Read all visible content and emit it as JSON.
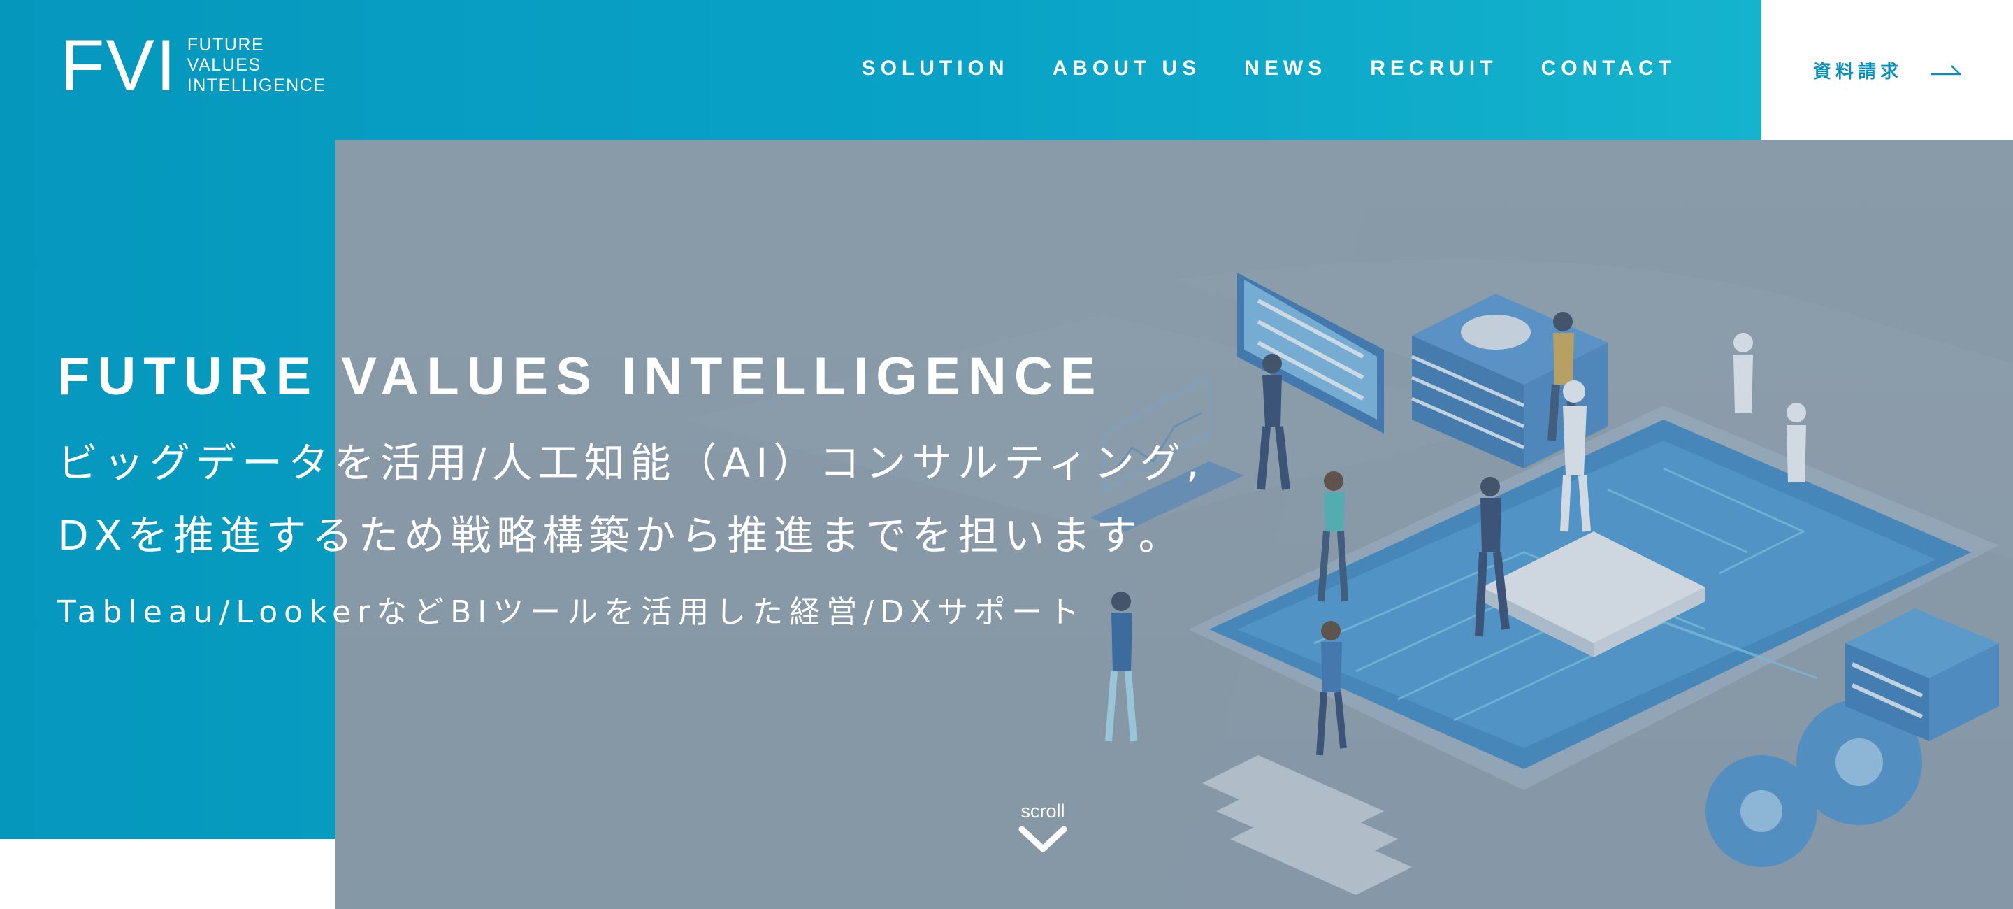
{
  "header": {
    "logo": {
      "mark": "FVI",
      "lines": [
        "FUTURE",
        "VALUES",
        "INTELLIGENCE"
      ]
    },
    "nav": [
      {
        "label": "SOLUTION"
      },
      {
        "label": "ABOUT US"
      },
      {
        "label": "NEWS"
      },
      {
        "label": "RECRUIT"
      },
      {
        "label": "CONTACT"
      }
    ],
    "request": {
      "label": "資料請求",
      "icon": "arrow-right-icon"
    }
  },
  "hero": {
    "title": "FUTURE VALUES INTELLIGENCE",
    "line1": "ビッグデータを活用/人工知能（AI）コンサルティング,",
    "line2": "DXを推進するため戦略構築から推進までを担います。",
    "line3": "Tableau/LookerなどBIツールを活用した経営/DXサポート",
    "image": "isometric-ai-data-illustration"
  },
  "scroll": {
    "label": "scroll",
    "icon": "chevron-down-icon"
  },
  "colors": {
    "primary_blue": "#0697bd",
    "accent_teal": "#19b9cf",
    "hero_overlay": "#8a9ca9",
    "request_text": "#0a8fb8"
  }
}
